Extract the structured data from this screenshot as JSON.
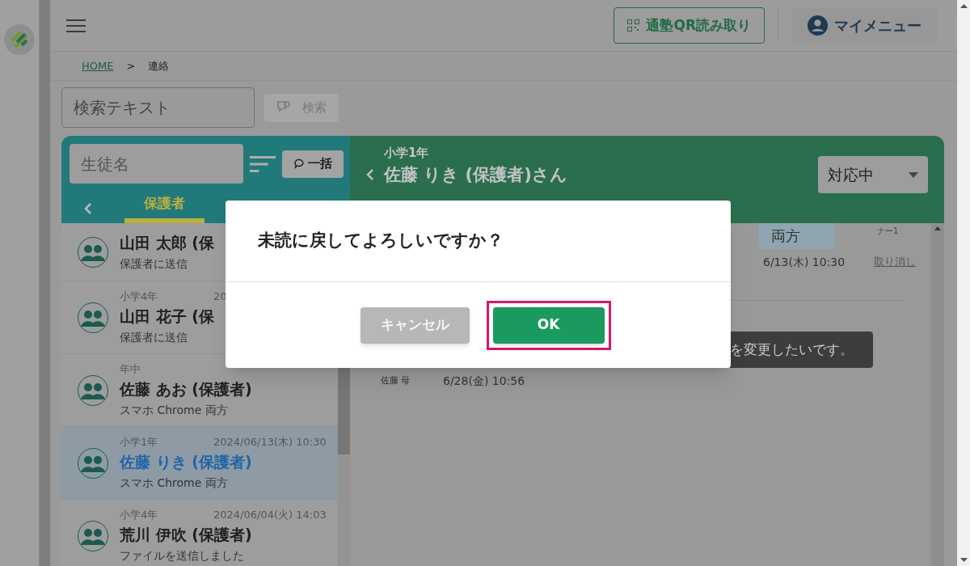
{
  "header": {
    "qr_button": "通塾QR読み取り",
    "my_menu": "マイメニュー"
  },
  "breadcrumb": {
    "home": "HOME",
    "separator": ">",
    "current": "連絡"
  },
  "search": {
    "placeholder": "検索テキスト",
    "button": "検索",
    "disabled": true
  },
  "student_panel": {
    "placeholder": "生徒名",
    "bulk_button": "一括",
    "tabs": [
      {
        "label": "保護者",
        "selected": true
      }
    ],
    "items": [
      {
        "name": "山田 太郎 (保",
        "detail": "保護者に送信",
        "selected": false
      },
      {
        "grade": "小学4年",
        "date": "20",
        "name": "山田 花子 (保",
        "detail": "保護者に送信",
        "selected": false
      },
      {
        "grade": "年中",
        "name": "佐藤 あお (保護者)",
        "detail": "スマホ Chrome 両方",
        "selected": false
      },
      {
        "grade": "小学1年",
        "date": "2024/06/13(木) 10:30",
        "name": "佐藤 りき (保護者)",
        "detail": "スマホ Chrome 両方",
        "selected": true
      },
      {
        "grade": "小学4年",
        "date": "2024/06/04(火) 14:03",
        "name": "荒川 伊吹 (保護者)",
        "detail": "ファイルを送信しました",
        "selected": false
      }
    ]
  },
  "conversation": {
    "grade": "小学1年",
    "title": "佐藤 りき (保護者)さん",
    "status": "対応中",
    "messages": [
      {
        "kind": "outgoing",
        "badge": "両方",
        "reader": "ナー1",
        "time": "6/13(木) 10:30",
        "action": "取り消し"
      },
      {
        "kind": "incoming",
        "text": "を変更したいです。",
        "sender": "佐藤 母",
        "time": "6/28(金) 10:56"
      }
    ]
  },
  "dialog": {
    "message": "未読に戻してよろしいですか？",
    "buttons": [
      {
        "label": "キャンセル",
        "kind": "cancel",
        "highlighted": false
      },
      {
        "label": "OK",
        "kind": "ok",
        "highlighted": true
      }
    ]
  }
}
